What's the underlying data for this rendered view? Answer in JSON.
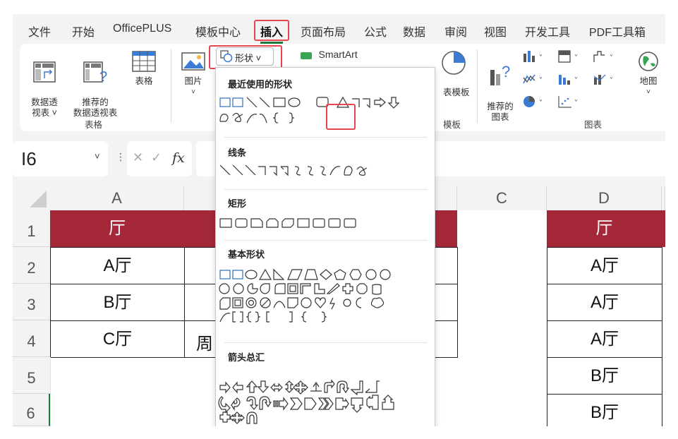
{
  "menu": {
    "tabs": [
      "文件",
      "开始",
      "OfficePLUS",
      "模板中心",
      "插入",
      "页面布局",
      "公式",
      "数据",
      "审阅",
      "视图",
      "开发工具",
      "PDF工具箱"
    ],
    "active_tab": "插入"
  },
  "ribbon": {
    "pivot_table": "数据透\n视表 ˅",
    "recommended_pivot": "推荐的\n数据透视表",
    "table": "表格",
    "group_tables": "表格",
    "pictures": "图片",
    "shapes_button": "形状 ˅",
    "smartart": "SmartArt",
    "chart_template": "表模板",
    "group_template": "模板",
    "recommended_charts": "推荐的\n图表",
    "map": "地图",
    "group_charts": "图表"
  },
  "formula_bar": {
    "name_box": "I6",
    "fx_label": "fx",
    "cancel_symbol": "✕",
    "enter_symbol": "✓"
  },
  "grid": {
    "columns": [
      "A",
      "C",
      "D"
    ],
    "rows": [
      "1",
      "2",
      "3",
      "4",
      "5",
      "6"
    ],
    "col_a": [
      "厅",
      "A厅",
      "B厅",
      "C厅"
    ],
    "col_b_partial": "周",
    "col_d": [
      "厅",
      "A厅",
      "A厅",
      "A厅",
      "B厅",
      "B厅"
    ],
    "header_color": "#a4283a"
  },
  "shapes_dropdown": {
    "recent": "最近使用的形状",
    "lines": "线条",
    "rectangles": "矩形",
    "basic": "基本形状",
    "arrows": "箭头总汇"
  },
  "colors": {
    "highlight": "#e8464e",
    "active_tab_underline": "#1f7a3f"
  }
}
